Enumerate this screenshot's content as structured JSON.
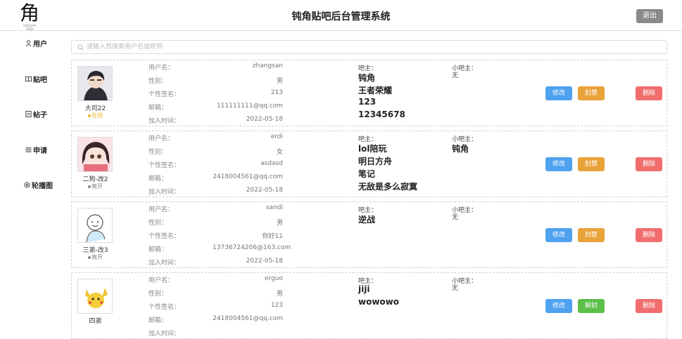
{
  "header": {
    "logo_char": "角",
    "logo_small": "DUN JIAO TIEBA",
    "title": "钝角贴吧后台管理系统",
    "logout_label": "退出"
  },
  "sidebar": {
    "items": [
      {
        "label": "用户",
        "icon": "user-icon"
      },
      {
        "label": "贴吧",
        "icon": "board-icon"
      },
      {
        "label": "帖子",
        "icon": "post-icon"
      },
      {
        "label": "申请",
        "icon": "list-icon"
      },
      {
        "label": "轮播图",
        "icon": "carousel-icon"
      }
    ]
  },
  "search": {
    "placeholder": "请输入想搜索用户名或昵称"
  },
  "labels": {
    "username": "用户名：",
    "gender": "性别：",
    "signature": "个性签名：",
    "email": "邮箱：",
    "joined": "加入时间：",
    "bar_owner": "吧主：",
    "sub_owner": "小吧主："
  },
  "users": [
    {
      "nickname": "大司22",
      "status": "在线",
      "status_color": "#e5b62b",
      "username": "zhangsan",
      "gender": "男",
      "signature": "213",
      "email": "111111111@qq.com",
      "joined": "2022-05-18",
      "bars": [
        "钝角",
        "王者荣耀",
        "123",
        "12345678"
      ],
      "sub_bars": [],
      "sub_empty": "无",
      "actions": {
        "edit": "修改",
        "ban": "封禁",
        "delete": "删除"
      }
    },
    {
      "nickname": "二狗-改2",
      "status": "离开",
      "status_color": "#888888",
      "username": "erdi",
      "gender": "女",
      "signature": "asdasd",
      "email": "2418004561@qq.com",
      "joined": "2022-05-18",
      "bars": [
        "lol陪玩",
        "明日方舟",
        "笔记",
        "无敌是多么寂寞"
      ],
      "sub_bars": [
        "钝角"
      ],
      "sub_empty": "",
      "actions": {
        "edit": "修改",
        "ban": "封禁",
        "delete": "删除"
      }
    },
    {
      "nickname": "三弟-改3",
      "status": "离开",
      "status_color": "#888888",
      "username": "sandi",
      "gender": "男",
      "signature": "你好11",
      "email": "13736724206@163.com",
      "joined": "2022-05-18",
      "bars": [
        "逆战"
      ],
      "sub_bars": [],
      "sub_empty": "无",
      "actions": {
        "edit": "修改",
        "ban": "封禁",
        "delete": "删除"
      }
    },
    {
      "nickname": "四弟",
      "status": "",
      "status_color": "#888888",
      "username": "erguo",
      "gender": "男",
      "signature": "123",
      "email": "2418004561@qq.com",
      "joined": "",
      "bars": [
        "jiji",
        "wowowo"
      ],
      "sub_bars": [],
      "sub_empty": "无",
      "actions": {
        "edit": "修改",
        "ban": "解封",
        "delete": "删除"
      }
    }
  ],
  "colors": {
    "edit": "#4ea2ef",
    "ban": "#e8a23a",
    "unban": "#5cbf4a",
    "delete": "#f06e6e",
    "logout": "#8a8a8a"
  }
}
